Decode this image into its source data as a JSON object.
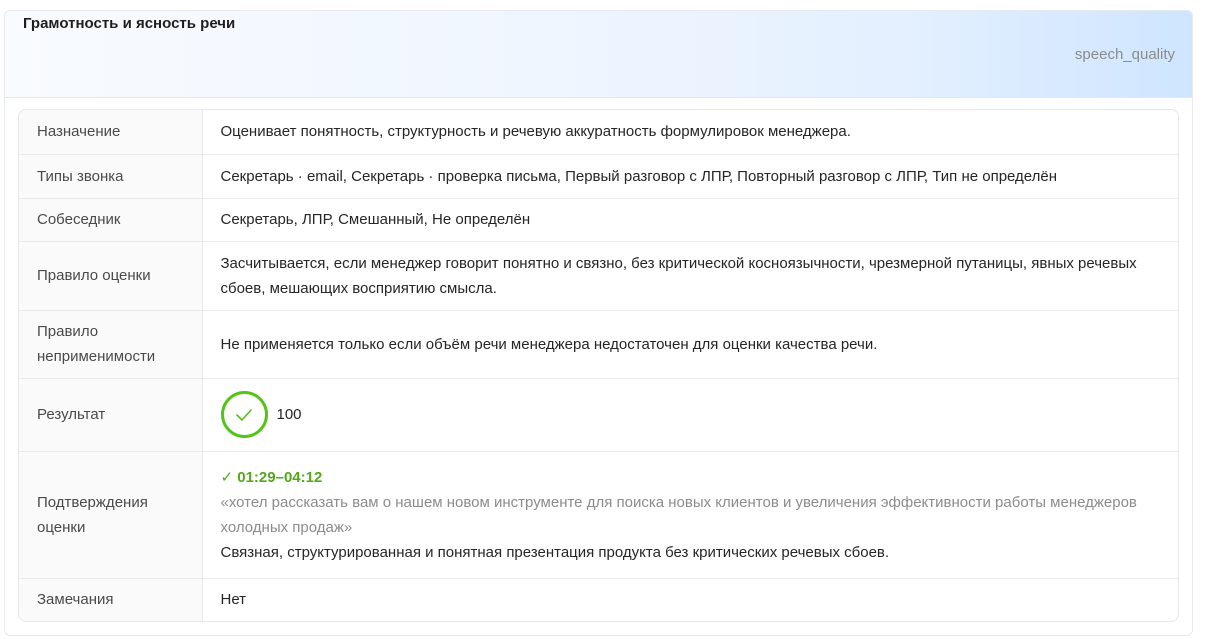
{
  "card": {
    "title": "Грамотность и ясность речи",
    "code": "speech_quality"
  },
  "rows": {
    "purpose": {
      "label": "Назначение",
      "value": "Оценивает понятность, структурность и речевую аккуратность формулировок менеджера."
    },
    "call_types": {
      "label": "Типы звонка",
      "value": "Секретарь · email, Секретарь · проверка письма, Первый разговор с ЛПР, Повторный разговор с ЛПР, Тип не определён"
    },
    "interlocutor": {
      "label": "Собеседник",
      "value": "Секретарь, ЛПР, Смешанный, Не определён"
    },
    "rule": {
      "label": "Правило оценки",
      "value": "Засчитывается, если менеджер говорит понятно и связно, без критической косноязычности, чрезмерной путаницы, явных речевых сбоев, мешающих восприятию смысла."
    },
    "inapplicability": {
      "label": "Правило неприменимости",
      "value": "Не применяется только если объём речи менеджера недостаточен для оценки качества речи."
    },
    "result": {
      "label": "Результат",
      "value": "100",
      "status_icon": "check-circle-icon",
      "status_color": "#52c41a"
    },
    "confirmations": {
      "label": "Подтверждения оценки",
      "timestamp": "✓ 01:29–04:12",
      "quote": "«хотел рассказать вам о нашем новом инструменте для поиска новых клиентов и увеличения эффективности работы менеджеров холодных продаж»",
      "comment": "Связная, структурированная и понятная презентация продукта без критических речевых сбоев."
    },
    "remarks": {
      "label": "Замечания",
      "value": "Нет"
    }
  }
}
